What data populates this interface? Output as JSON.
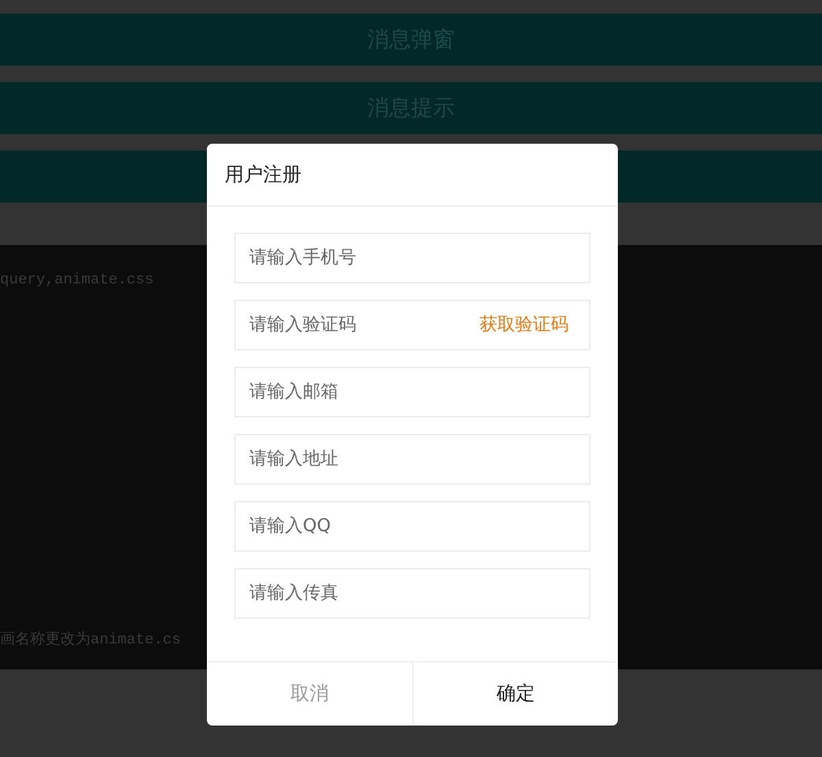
{
  "menu_bars": [
    {
      "label": "消息弹窗"
    },
    {
      "label": "消息提示"
    }
  ],
  "code_panel": {
    "lines": [
      "query,animate.css",
      "画名称更改为animate.cs"
    ]
  },
  "dialog": {
    "title": "用户注册",
    "fields": [
      {
        "placeholder": "请输入手机号"
      },
      {
        "placeholder": "请输入验证码",
        "action": "获取验证码"
      },
      {
        "placeholder": "请输入邮箱"
      },
      {
        "placeholder": "请输入地址"
      },
      {
        "placeholder": "请输入QQ"
      },
      {
        "placeholder": "请输入传真"
      }
    ],
    "buttons": [
      {
        "label": "取消",
        "kind": "cancel"
      },
      {
        "label": "确定",
        "kind": "confirm"
      }
    ]
  }
}
